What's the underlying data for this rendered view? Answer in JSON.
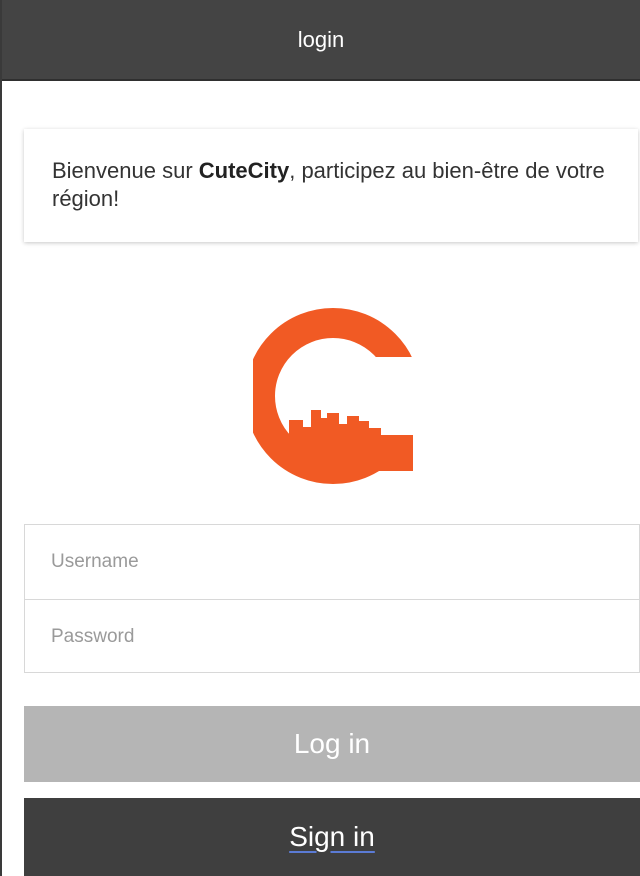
{
  "header": {
    "title": "login"
  },
  "welcome": {
    "text_before": "Bienvenue sur ",
    "brand": "CuteCity",
    "text_after": ", participez au bien-être de votre région!"
  },
  "logo": {
    "icon": "cutecity-logo-icon",
    "color": "#f15a24"
  },
  "form": {
    "username_placeholder": "Username",
    "username_value": "",
    "password_placeholder": "Password",
    "password_value": ""
  },
  "buttons": {
    "login_label": "Log in",
    "signin_label": "Sign in"
  }
}
